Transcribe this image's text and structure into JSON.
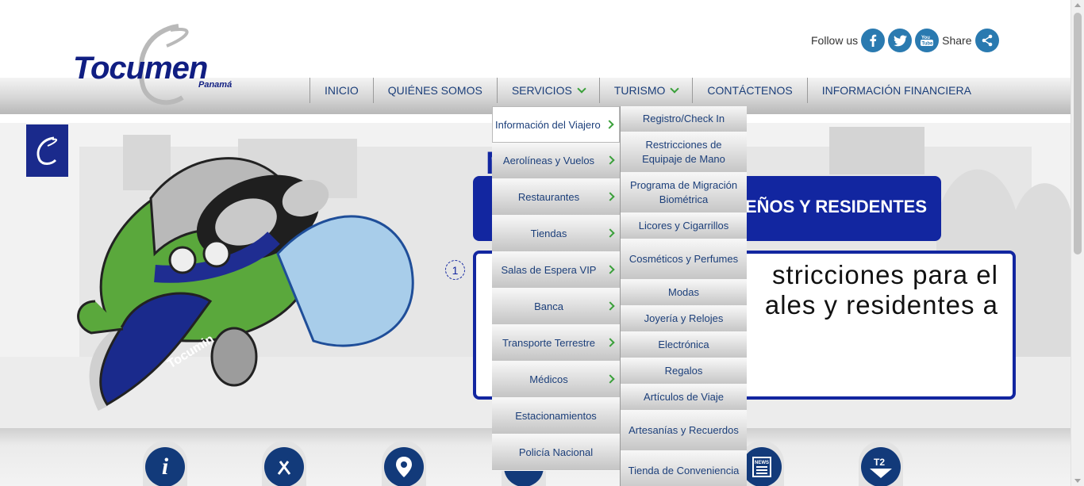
{
  "header": {
    "logo_text": "Tocumen",
    "logo_subtext": "Panamá",
    "follow_label": "Follow us",
    "share_label": "Share",
    "social_icons": [
      "facebook-icon",
      "twitter-icon",
      "youtube-icon",
      "share-icon"
    ]
  },
  "nav": {
    "items": [
      {
        "label": "INICIO"
      },
      {
        "label": "QUIÉNES SOMOS"
      },
      {
        "label": "SERVICIOS"
      },
      {
        "label": "TURISMO"
      },
      {
        "label": "CONTÁCTENOS"
      },
      {
        "label": "INFORMACIÓN FINANCIERA"
      }
    ]
  },
  "servicios_menu": {
    "items": [
      {
        "label": "Información del Viajero"
      },
      {
        "label": "Aerolíneas y Vuelos"
      },
      {
        "label": "Restaurantes"
      },
      {
        "label": "Tiendas"
      },
      {
        "label": "Salas de Espera VIP"
      },
      {
        "label": "Banca"
      },
      {
        "label": "Transporte Terrestre"
      },
      {
        "label": "Médicos"
      },
      {
        "label": "Estacionamientos"
      },
      {
        "label": "Policía Nacional"
      }
    ]
  },
  "viajero_submenu": {
    "items": [
      {
        "label": "Registro/Check In"
      },
      {
        "label": "Restricciones de Equipaje de Mano"
      },
      {
        "label": "Programa de Migración Biométrica"
      },
      {
        "label": "Licores y Cigarrillos"
      },
      {
        "label": "Cosméticos y Perfumes"
      },
      {
        "label": "Modas"
      },
      {
        "label": "Joyería y Relojes"
      },
      {
        "label": "Electrónica"
      },
      {
        "label": "Regalos"
      },
      {
        "label": "Artículos de Viaje"
      },
      {
        "label": "Artesanías y Recuerdos"
      },
      {
        "label": "Tienda de Conveniencia"
      }
    ]
  },
  "hero": {
    "headline_fragment": "N",
    "title_fragment": "EÑOS Y RESIDENTES",
    "slide_number": "1",
    "slide_line1": "stricciones para el",
    "slide_line2": "ales y residentes a",
    "mascot_label": "Tocumin"
  },
  "quick_links": {
    "icons": [
      "info-icon",
      "restaurant-icon",
      "location-icon",
      "parking-icon",
      "news-icon",
      "terminal-2-icon"
    ],
    "t2_label": "T2",
    "news_label": "NEWS"
  },
  "colors": {
    "brand_blue": "#101e82",
    "nav_text": "#1c3f7a",
    "accent_green": "#3aa03a",
    "social_blue": "#2a7ab0"
  }
}
